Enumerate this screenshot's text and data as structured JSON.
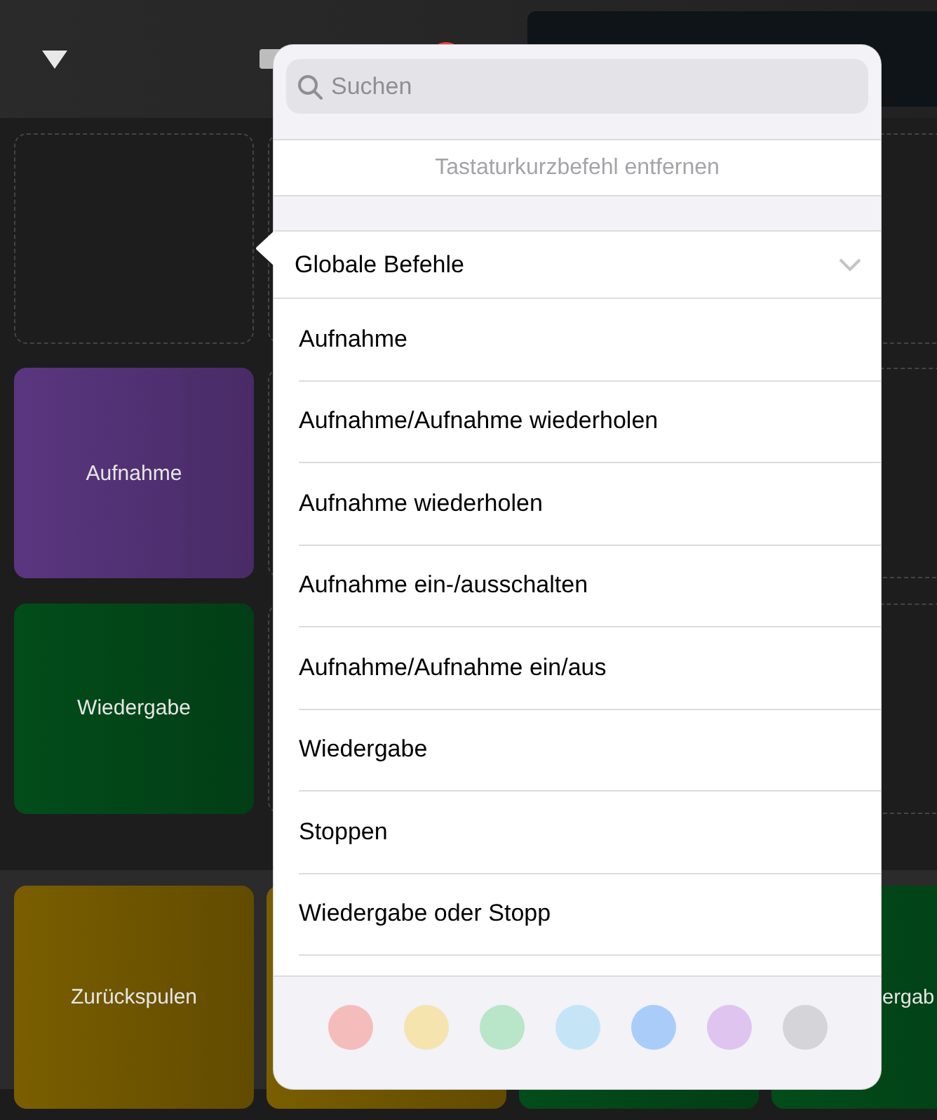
{
  "pad_grid": [
    {
      "kind": "empty"
    },
    {
      "kind": "empty"
    },
    {
      "kind": "empty"
    },
    {
      "kind": "command",
      "label": "Aufnahme",
      "color": "#5a3680"
    },
    {
      "kind": "empty"
    },
    {
      "kind": "empty"
    },
    {
      "kind": "command",
      "label": "Wiedergabe",
      "color": "#024d1a"
    },
    {
      "kind": "empty"
    },
    {
      "kind": "empty"
    }
  ],
  "transport_pads": [
    {
      "kind": "command",
      "label": "Zurückspulen",
      "color": "#7a5e00"
    },
    {
      "kind": "command",
      "color": "#7a5e00"
    },
    {
      "kind": "command",
      "color": "#024d1a"
    },
    {
      "kind": "command",
      "label": "ergab",
      "color": "#024d1a"
    }
  ],
  "popover": {
    "search": {
      "placeholder": "Suchen"
    },
    "remove_action": "Tastaturkurzbefehl entfernen",
    "section": {
      "title": "Globale Befehle",
      "expanded": true
    },
    "items": [
      "Aufnahme",
      "Aufnahme/Aufnahme wiederholen",
      "Aufnahme wiederholen",
      "Aufnahme ein-/ausschalten",
      "Aufnahme/Aufnahme ein/aus",
      "Wiedergabe",
      "Stoppen",
      "Wiedergabe oder Stopp"
    ],
    "colors": [
      {
        "color": "#f5bcbc"
      },
      {
        "color": "#f5e4ae"
      },
      {
        "color": "#b9e5c9"
      },
      {
        "color": "#c5e5f7"
      },
      {
        "color": "#a9cdf8"
      },
      {
        "color": "#dec4ef"
      },
      {
        "color": "#d4d4d9"
      }
    ]
  }
}
